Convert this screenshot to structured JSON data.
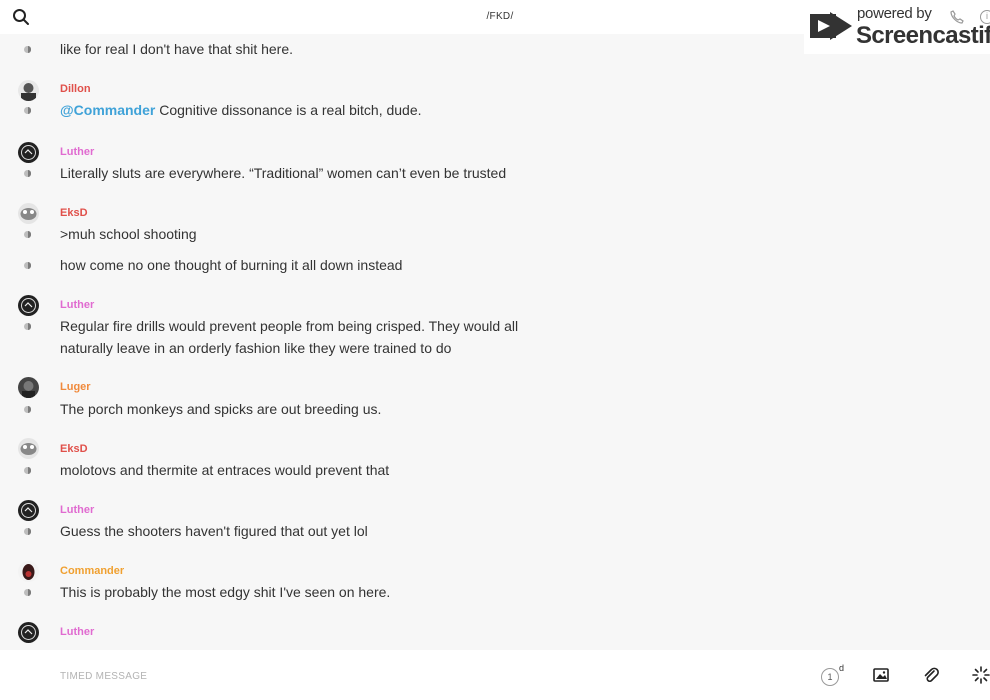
{
  "header": {
    "title": "/FKD/"
  },
  "watermark": {
    "powered": "powered by",
    "brand": "Screencastify"
  },
  "messages": [
    {
      "text": "like for real I don't have that shit here."
    },
    {
      "user": "Dillon",
      "user_color": "#e0504a",
      "mention": "@Commander",
      "text": " Cognitive dissonance is a real bitch, dude."
    },
    {
      "user": "Luther",
      "user_color": "#e06bd0",
      "text": "Literally sluts are everywhere. “Traditional” women can’t even be trusted"
    },
    {
      "user": "EksD",
      "user_color": "#e0504a",
      "text": ">muh school shooting"
    },
    {
      "text": "how come no one thought of burning it all down instead"
    },
    {
      "user": "Luther",
      "user_color": "#e06bd0",
      "text": "Regular fire drills would prevent people from being crisped. They would all naturally leave in an orderly fashion like they were trained to do"
    },
    {
      "user": "Luger",
      "user_color": "#f08a3c",
      "text": "The porch monkeys and spicks are out breeding us."
    },
    {
      "user": "EksD",
      "user_color": "#e0504a",
      "text": "molotovs and thermite at entraces would prevent that"
    },
    {
      "user": "Luther",
      "user_color": "#e06bd0",
      "text": "Guess the shooters haven't figured that out yet lol"
    },
    {
      "user": "Commander",
      "user_color": "#f0a030",
      "text": "This is probably the most edgy shit I've seen on here."
    },
    {
      "user": "Luther",
      "user_color": "#e06bd0"
    }
  ],
  "composer": {
    "placeholder": "TIMED MESSAGE",
    "timer_value": "1",
    "timer_unit": "d"
  },
  "icons": {
    "search": "search-icon",
    "timer": "timer-icon",
    "image": "image-icon",
    "attach": "paperclip-icon",
    "sparkle": "sparkle-icon"
  }
}
